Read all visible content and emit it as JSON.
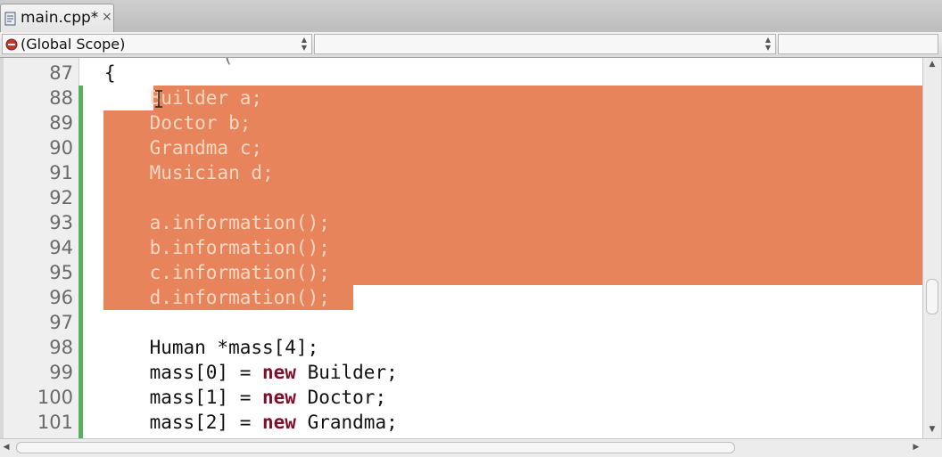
{
  "tab": {
    "title": "main.cpp*",
    "close": "×"
  },
  "scope": {
    "label": "(Global Scope)",
    "member_value": ""
  },
  "editor": {
    "top_partial": "(",
    "lines": [
      {
        "n": "87",
        "text": "{"
      },
      {
        "n": "88",
        "text": "    Builder a;"
      },
      {
        "n": "89",
        "text": "    Doctor b;"
      },
      {
        "n": "90",
        "text": "    Grandma c;"
      },
      {
        "n": "91",
        "text": "    Musician d;"
      },
      {
        "n": "92",
        "text": ""
      },
      {
        "n": "93",
        "text": "    a.information();"
      },
      {
        "n": "94",
        "text": "    b.information();"
      },
      {
        "n": "95",
        "text": "    c.information();"
      },
      {
        "n": "96",
        "text": "    d.information();"
      },
      {
        "n": "97",
        "text": ""
      },
      {
        "n": "98",
        "text": "    Human *mass[4];"
      },
      {
        "n": "99",
        "pre": "    mass[0] = ",
        "kw": "new",
        "post": " Builder;"
      },
      {
        "n": "100",
        "pre": "    mass[1] = ",
        "kw": "new",
        "post": " Doctor;"
      },
      {
        "n": "101",
        "pre": "    mass[2] = ",
        "kw": "new",
        "post": " Grandma;"
      }
    ],
    "selected_lines": [
      "88",
      "89",
      "90",
      "91",
      "92",
      "93",
      "94",
      "95",
      "96"
    ]
  },
  "colors": {
    "selection": "#e8845c",
    "keyword": "#7f0f2b",
    "change_bar": "#58b058",
    "line_number": "#6a6a6a"
  },
  "icons": {
    "tab": "cpp-file-icon",
    "scope": "scope-stop-icon"
  }
}
